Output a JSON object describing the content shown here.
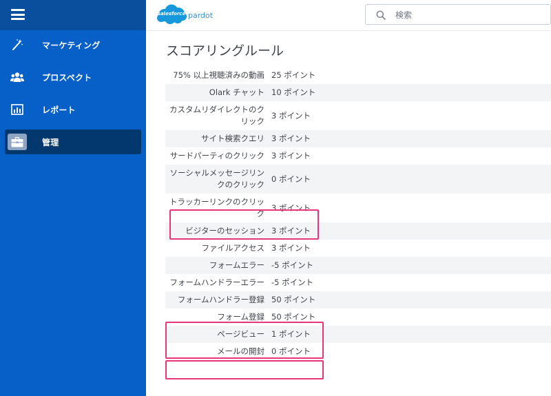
{
  "brand": {
    "cloud_text": "salesforce",
    "product": "pardot"
  },
  "search": {
    "placeholder": "検索"
  },
  "nav": {
    "items": [
      {
        "label": "マーケティング",
        "icon": "magic-wand-icon"
      },
      {
        "label": "プロスペクト",
        "icon": "people-icon"
      },
      {
        "label": "レポート",
        "icon": "report-chart-icon"
      },
      {
        "label": "管理",
        "icon": "briefcase-icon",
        "active": true
      }
    ]
  },
  "page": {
    "title": "スコアリングルール"
  },
  "rules": [
    {
      "name": "75% 以上視聴済みの動画",
      "points": "25 ポイント"
    },
    {
      "name": "Olark チャット",
      "points": "10 ポイント"
    },
    {
      "name": "カスタムリダイレクトのクリック",
      "points": "3 ポイント"
    },
    {
      "name": "サイト検索クエリ",
      "points": "3 ポイント"
    },
    {
      "name": "サードパーティのクリック",
      "points": "3 ポイント"
    },
    {
      "name": "ソーシャルメッセージリンクのクリック",
      "points": "0 ポイント"
    },
    {
      "name": "トラッカーリンクのクリック",
      "points": "3 ポイント"
    },
    {
      "name": "ビジターのセッション",
      "points": "3 ポイント"
    },
    {
      "name": "ファイルアクセス",
      "points": "3 ポイント"
    },
    {
      "name": "フォームエラー",
      "points": "-5 ポイント"
    },
    {
      "name": "フォームハンドラーエラー",
      "points": "-5 ポイント"
    },
    {
      "name": "フォームハンドラー登録",
      "points": "50 ポイント"
    },
    {
      "name": "フォーム登録",
      "points": "50 ポイント"
    },
    {
      "name": "ページビュー",
      "points": "1 ポイント"
    },
    {
      "name": "メールの開封",
      "points": "0 ポイント"
    }
  ],
  "colors": {
    "sidebar": "#0760c8",
    "sidebar_top": "#0a4f9e",
    "active_item": "#03386f",
    "highlight": "#e8357a"
  }
}
